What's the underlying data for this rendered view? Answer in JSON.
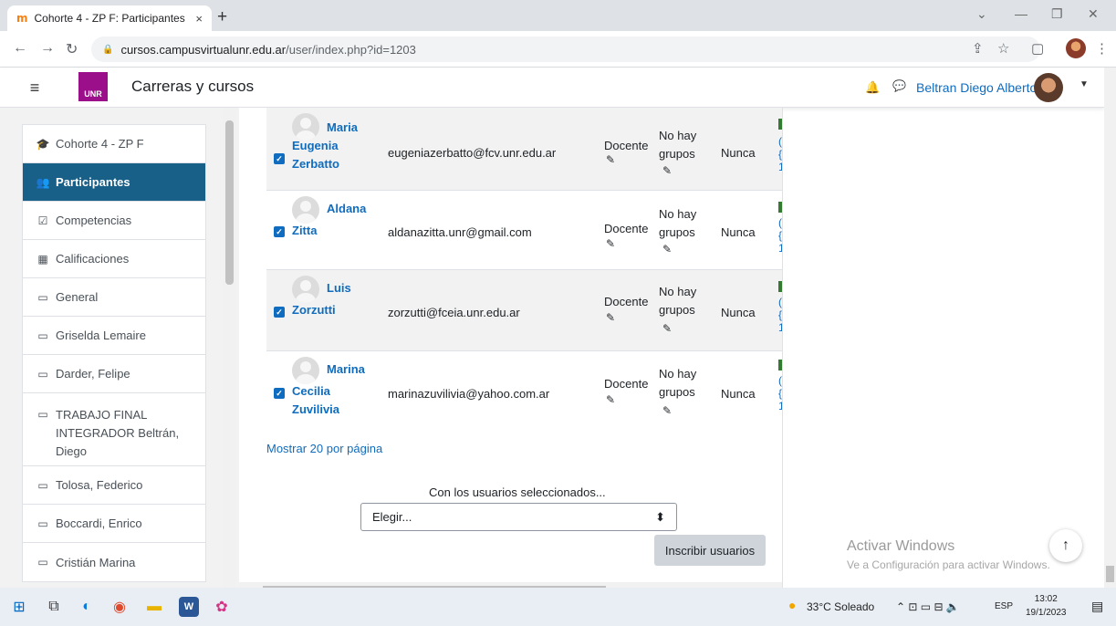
{
  "browser": {
    "tab_title": "Cohorte 4 - ZP F: Participantes",
    "tab_favicon": "m",
    "tab_close": "×",
    "new_tab": "+",
    "url_host": "cursos.campusvirtualunr.edu.ar",
    "url_path": "/user/index.php?id=1203"
  },
  "navbar": {
    "logo": "UNR",
    "site_name": "Carreras y cursos",
    "user_name": "Beltran Diego Alberto"
  },
  "drawer": {
    "items": [
      {
        "label": "Cohorte 4 - ZP F",
        "icon": "graduation-cap-icon"
      },
      {
        "label": "Participantes",
        "icon": "users-icon",
        "active": true
      },
      {
        "label": "Competencias",
        "icon": "checkbox-icon"
      },
      {
        "label": "Calificaciones",
        "icon": "table-icon"
      },
      {
        "label": "General",
        "icon": "folder-icon"
      },
      {
        "label": "Griselda Lemaire",
        "icon": "folder-icon"
      },
      {
        "label": "Darder, Felipe",
        "icon": "folder-icon"
      },
      {
        "label": "TRABAJO FINAL INTEGRADOR Beltrán, Diego",
        "icon": "folder-icon"
      },
      {
        "label": "Tolosa, Federico",
        "icon": "folder-icon"
      },
      {
        "label": "Boccardi, Enrico",
        "icon": "folder-icon"
      },
      {
        "label": "Cristián Marina",
        "icon": "folder-icon"
      }
    ]
  },
  "participants": [
    {
      "first": "Maria",
      "rest1": "Eugenia",
      "rest2": "Zerbatto",
      "email": "eugeniazerbatto@fcv.unr.edu.ar",
      "role": "Docente",
      "groups1": "No hay",
      "groups2": "grupos",
      "last_access": "Nunca",
      "selected": true
    },
    {
      "first": "Aldana",
      "rest1": "Zitta",
      "rest2": "",
      "email": "aldanazitta.unr@gmail.com",
      "role": "Docente",
      "groups1": "No hay",
      "groups2": "grupos",
      "last_access": "Nunca",
      "selected": true
    },
    {
      "first": "Luis",
      "rest1": "Zorzutti",
      "rest2": "",
      "email": "zorzutti@fceia.unr.edu.ar",
      "role": "Docente",
      "groups1": "No hay",
      "groups2": "grupos",
      "last_access": "Nunca",
      "selected": true
    },
    {
      "first": "Marina",
      "rest1": "Cecilia",
      "rest2": "Zuvilivia",
      "email": "marinazuvilivia@yahoo.com.ar",
      "role": "Docente",
      "groups1": "No hay",
      "groups2": "grupos",
      "last_access": "Nunca",
      "selected": true
    }
  ],
  "table_footer": {
    "per_page_link": "Mostrar 20 por página",
    "with_selected_label": "Con los usuarios seleccionados...",
    "select_value": "Elegir...",
    "enroll_button": "Inscribir usuarios"
  },
  "windows": {
    "activate_title": "Activar Windows",
    "activate_sub": "Ve a Configuración para activar Windows.",
    "weather": "33°C  Soleado",
    "lang": "ESP",
    "time": "13:02",
    "date": "19/1/2023"
  }
}
